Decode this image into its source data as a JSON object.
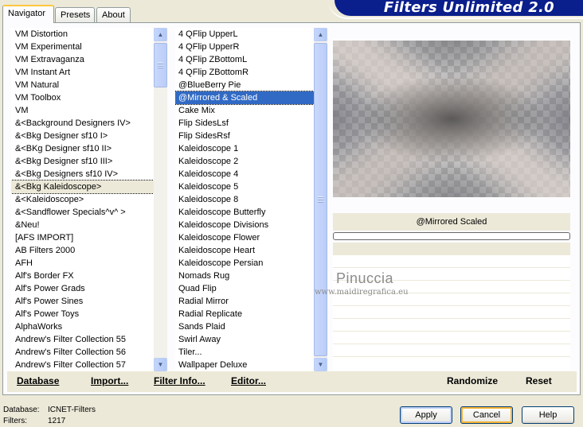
{
  "tabs": [
    "Navigator",
    "Presets",
    "About"
  ],
  "app_title": "Filters Unlimited 2.0",
  "categories": [
    "VM Distortion",
    "VM Experimental",
    "VM Extravaganza",
    "VM Instant Art",
    "VM Natural",
    "VM Toolbox",
    "VM",
    "&<Background Designers IV>",
    "&<Bkg Designer sf10 I>",
    "&<BKg Designer sf10 II>",
    "&<Bkg Designer sf10 III>",
    "&<Bkg Designers sf10 IV>",
    "&<Bkg Kaleidoscope>",
    "&<Kaleidoscope>",
    "&<Sandflower Specials^v^ >",
    "&Neu!",
    "[AFS IMPORT]",
    "AB Filters 2000",
    "AFH",
    "Alf's Border FX",
    "Alf's Power Grads",
    "Alf's Power Sines",
    "Alf's Power Toys",
    "AlphaWorks",
    "Andrew's Filter Collection 55",
    "Andrew's Filter Collection 56",
    "Andrew's Filter Collection 57"
  ],
  "selected_category_index": 12,
  "filters": [
    "4 QFlip UpperL",
    "4 QFlip UpperR",
    "4 QFlip ZBottomL",
    "4 QFlip ZBottomR",
    "@BlueBerry Pie",
    "@Mirrored & Scaled",
    "Cake Mix",
    "Flip SidesLsf",
    "Flip SidesRsf",
    "Kaleidoscope 1",
    "Kaleidoscope 2",
    "Kaleidoscope 4",
    "Kaleidoscope 5",
    "Kaleidoscope 8",
    "Kaleidoscope Butterfly",
    "Kaleidoscope Divisions",
    "Kaleidoscope Flower",
    "Kaleidoscope Heart",
    "Kaleidoscope Persian",
    "Nomads Rug",
    "Quad Flip",
    "Radial Mirror",
    "Radial Replicate",
    "Sands Plaid",
    "Swirl Away",
    "Tiler...",
    "Wallpaper Deluxe"
  ],
  "selected_filter_index": 5,
  "current_filter_label": "@Mirrored  Scaled",
  "progress": 0,
  "watermark": {
    "name": "Pinuccia",
    "url": "www.maidiregrafica.eu"
  },
  "toolbar": {
    "database": "Database",
    "import": "Import...",
    "filter_info": "Filter Info...",
    "editor": "Editor...",
    "randomize": "Randomize",
    "reset": "Reset"
  },
  "status": {
    "database_label": "Database:",
    "database_value": "ICNET-Filters",
    "filters_label": "Filters:",
    "filters_value": "1217"
  },
  "buttons": {
    "apply": "Apply",
    "cancel": "Cancel",
    "help": "Help"
  },
  "colors": {
    "selection": "#316ac5",
    "banner": "#0a1e8c",
    "tab_highlight": "#ffc83c"
  }
}
